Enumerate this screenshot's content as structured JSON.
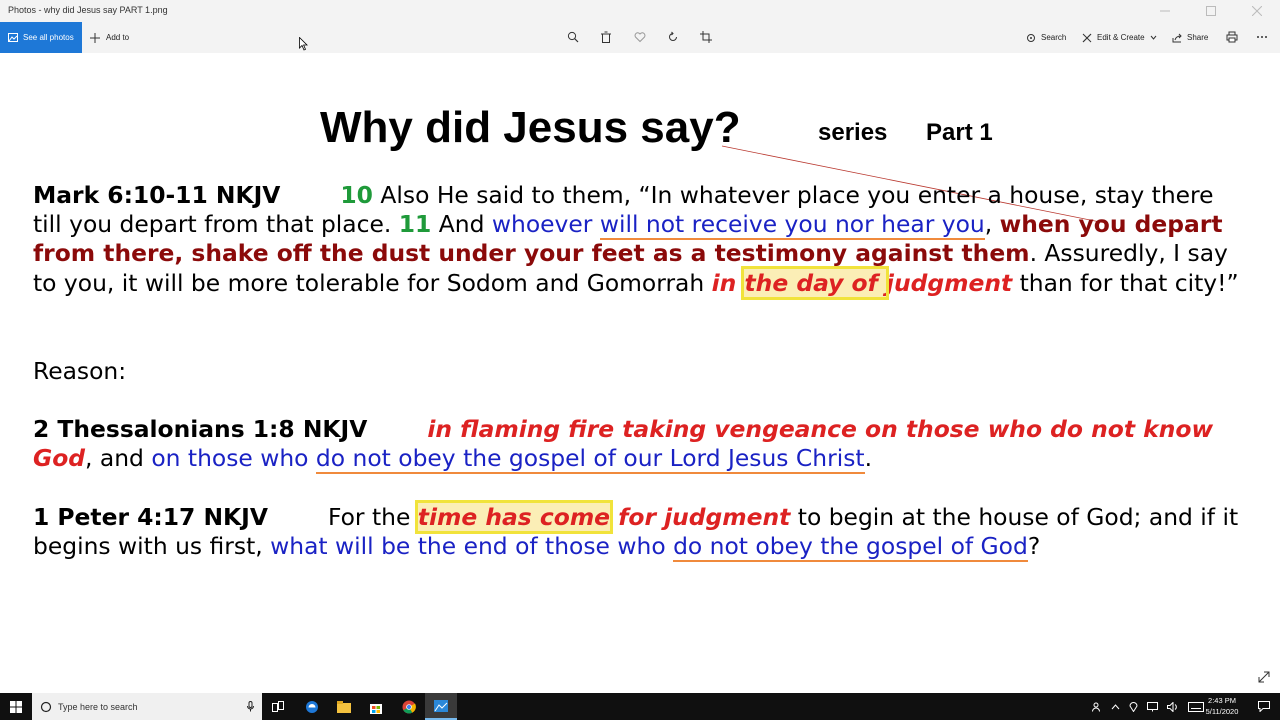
{
  "window": {
    "title": "Photos - why did Jesus say PART 1.png"
  },
  "toolbar": {
    "see_all_photos": "See all photos",
    "add_to": "Add to",
    "search": "Search",
    "edit_create": "Edit & Create",
    "share": "Share"
  },
  "slide": {
    "title": "Why did Jesus say?",
    "series": "series",
    "part": "Part 1",
    "mark": {
      "ref": "Mark 6:10-11 NKJV",
      "v10": "10",
      "t1": " Also He said to them, “In whatever place you enter a house, stay there till you depart from that place. ",
      "v11": "11",
      "t2": " And ",
      "whoever": "whoever ",
      "not_receive": "will not receive you nor hear you",
      "comma": ", ",
      "shake": "when you depart from there, shake off the dust under your feet as a testimony against them",
      "t3": ". Assuredly, I say to you, it will be more tolerable for Sodom and Gomorrah ",
      "in": "in ",
      "day_of": "the day of ",
      "judgment": "judgment",
      "t4": " than for that city!”"
    },
    "reason": "Reason:",
    "thess": {
      "ref": "2 Thessalonians 1:8 NKJV",
      "flaming": "in flaming fire taking vengeance on those who do not know God",
      "t1": ", and ",
      "on_those": "on those who ",
      "not_obey": "do not obey the gospel of our Lord Jesus Christ",
      "end": "."
    },
    "peter": {
      "ref": "1 Peter 4:17 NKJV",
      "t1": "For the ",
      "time_come": "time has come",
      "for_judgment": " for judgment",
      "t2": " to begin at the house of God; and if it begins with us first, ",
      "what_end": "what will be the end of those who ",
      "not_obey": "do not obey the gospel of God",
      "end": "?"
    }
  },
  "taskbar": {
    "search_placeholder": "Type here to search",
    "time": "2:43 PM",
    "date": "5/11/2020"
  },
  "colors": {
    "accent": "#1e78d7",
    "verse_number": "#1f9a3a",
    "blue_text": "#1a22c4",
    "maroon_text": "#8b0a0a",
    "red_text": "#dd2222",
    "underline": "#f08a3c",
    "highlight": "#f1e33b"
  }
}
